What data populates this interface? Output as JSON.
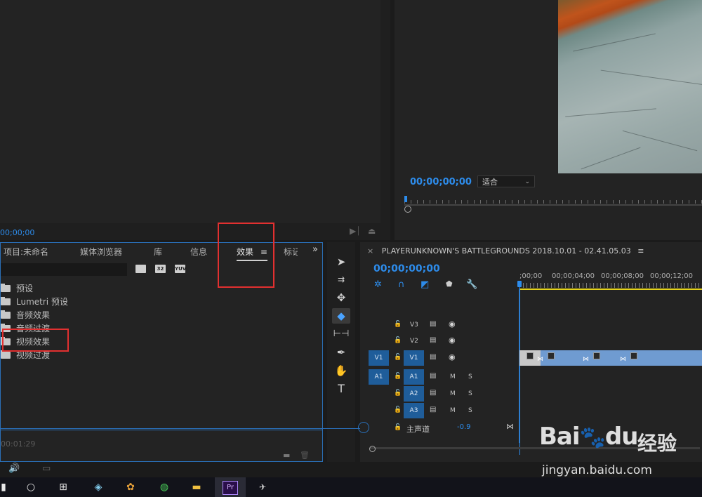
{
  "source_monitor": {
    "timecode": "00;00;00"
  },
  "program_monitor": {
    "timecode": "00;00;00;00",
    "fit_option": "适合"
  },
  "effects_panel": {
    "tabs": [
      "项目:未命名",
      "媒体浏览器",
      "库",
      "信息",
      "效果",
      "标记"
    ],
    "active_tab": "效果",
    "menu_icon": "≡",
    "overflow_icon": "»",
    "filter_badges": [
      "",
      "32",
      "YUV"
    ],
    "tree": [
      "预设",
      "Lumetri 预设",
      "音频效果",
      "音频过渡",
      "视频效果",
      "视频过渡"
    ],
    "footer_time": "00:01:29"
  },
  "tools": [
    "selection-tool",
    "track-select-tool",
    "ripple-edit-tool",
    "razor-tool",
    "slip-tool",
    "pen-tool",
    "hand-tool",
    "type-tool"
  ],
  "timeline": {
    "close": "×",
    "sequence_name": "PLAYERUNKNOWN'S BATTLEGROUNDS 2018.10.01 - 02.41.05.03",
    "menu_icon": "≡",
    "timecode": "00;00;00;00",
    "ruler_labels": [
      ";00;00",
      "00;00;04;00",
      "00;00;08;00",
      "00;00;12;00"
    ],
    "video_tracks": [
      {
        "name": "V3"
      },
      {
        "name": "V2"
      },
      {
        "name": "V1",
        "source_patch": "V1"
      }
    ],
    "audio_tracks": [
      {
        "name": "A1",
        "source_patch": "A1",
        "m": "M",
        "s": "S"
      },
      {
        "name": "A2",
        "m": "M",
        "s": "S"
      },
      {
        "name": "A3",
        "m": "M",
        "s": "S"
      }
    ],
    "master": {
      "label": "主声道",
      "value": "-0.9"
    }
  },
  "watermark": {
    "logo": "Bai",
    "logo_suffix": "du",
    "cn": "经验",
    "url": "jingyan.baidu.com"
  },
  "colors": {
    "accent": "#2d8ceb",
    "highlight_box": "#e23030",
    "track_target": "#1f5d9a",
    "clip": "#6f9bd1"
  }
}
